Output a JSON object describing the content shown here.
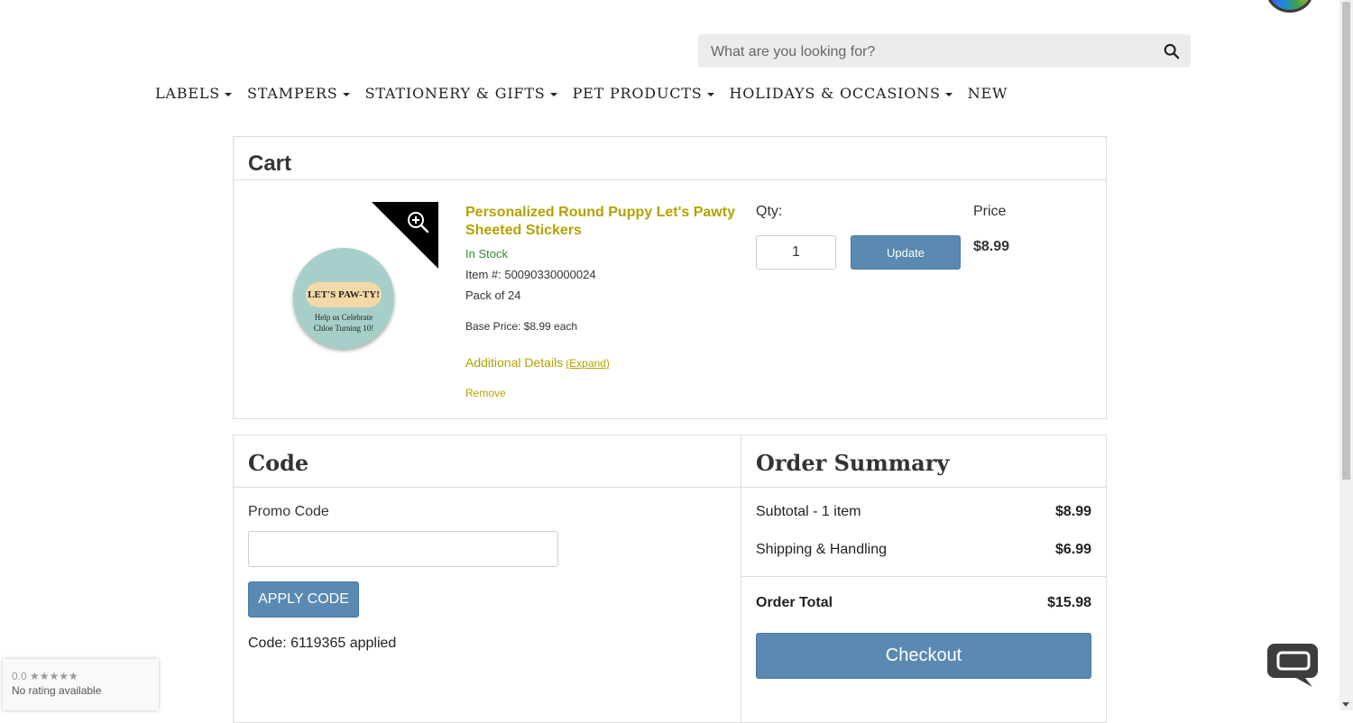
{
  "search": {
    "placeholder": "What are you looking for?"
  },
  "nav": {
    "items": [
      {
        "label": "LABELS",
        "has_dropdown": true
      },
      {
        "label": "STAMPERS",
        "has_dropdown": true
      },
      {
        "label": "STATIONERY & GIFTS",
        "has_dropdown": true
      },
      {
        "label": "PET PRODUCTS",
        "has_dropdown": true
      },
      {
        "label": "HOLIDAYS & OCCASIONS",
        "has_dropdown": true
      },
      {
        "label": "NEW",
        "has_dropdown": false
      }
    ]
  },
  "cart": {
    "title": "Cart",
    "item": {
      "name": "Personalized Round Puppy Let's Pawty Sheeted Stickers",
      "stock": "In Stock",
      "item_number": "Item #: 50090330000024",
      "pack": "Pack of 24",
      "base_price": "Base Price: $8.99 each",
      "additional_details": "Additional Details",
      "expand": "(Expand)",
      "remove": "Remove",
      "qty_label": "Qty:",
      "qty_value": "1",
      "update_label": "Update",
      "price_label": "Price",
      "price_value": "$8.99",
      "sticker_line1": "LET'S PAW-TY!",
      "sticker_line2": "Help us Celebrate",
      "sticker_line3": "Chloe Turning 10!"
    }
  },
  "code": {
    "title": "Code",
    "promo_label": "Promo Code",
    "promo_value": "",
    "apply_label": "APPLY CODE",
    "applied_text": "Code: 6119365 applied"
  },
  "summary": {
    "title": "Order Summary",
    "subtotal_label": "Subtotal - 1 item",
    "subtotal_value": "$8.99",
    "shipping_label": "Shipping & Handling",
    "shipping_value": "$6.99",
    "total_label": "Order Total",
    "total_value": "$15.98",
    "checkout_label": "Checkout"
  },
  "rating_widget": {
    "score": "0.0 ★★★★★",
    "text": "No rating available"
  },
  "colors": {
    "accent": "#5a89b1",
    "product_link": "#b3a200",
    "in_stock": "#2e8b2e"
  }
}
